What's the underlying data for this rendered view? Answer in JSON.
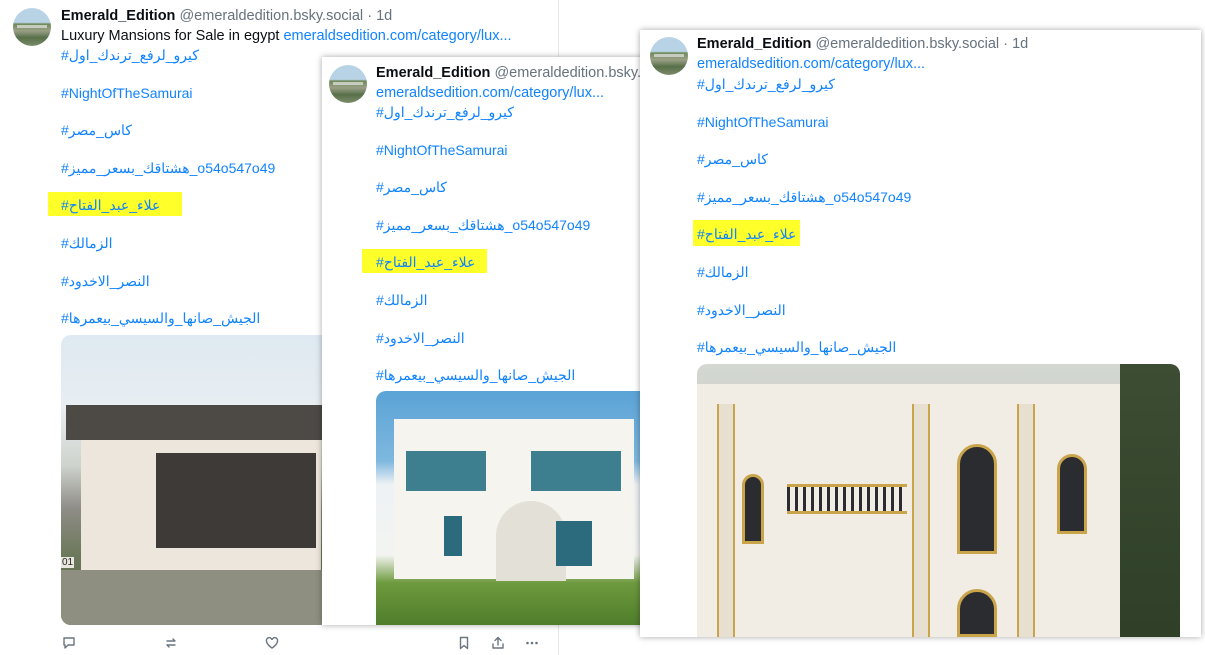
{
  "posts": [
    {
      "author": {
        "name": "Emerald_Edition",
        "handle": "@emeraldedition.bsky.social",
        "dot": "·",
        "time": "1d"
      },
      "text_prefix": "Luxury Mansions for Sale in egypt ",
      "link": "emeraldsedition.com/category/lux...",
      "hashtags": [
        "#كيرو_لرفع_ترندك_اول",
        "#NightOfTheSamurai",
        "#كاس_مصر",
        "#هشتاقك_بسعر_مميز_o54o547o49",
        "#علاء_عبد_الفتاح",
        "#الزمالك",
        "#النصر_الاخدود",
        "#الجيش_صانها_والسيسي_بيعمرها"
      ],
      "highlighted_index": 4,
      "image_alt": "modern single-storey villa",
      "image_number": "01"
    },
    {
      "author": {
        "name": "Emerald_Edition",
        "handle": "@emeraldedition.bsky.",
        "dot": "",
        "time": ""
      },
      "text_prefix": "",
      "link": "emeraldsedition.com/category/lux...",
      "hashtags": [
        "#كيرو_لرفع_ترندك_اول",
        "#NightOfTheSamurai",
        "#كاس_مصر",
        "#هشتاقك_بسعر_مميز_o54o547o49",
        "#علاء_عبد_الفتاح",
        "#الزمالك",
        "#النصر_الاخدود",
        "#الجيش_صانها_والسيسي_بيعمرها"
      ],
      "highlighted_index": 4,
      "image_alt": "white coastal villa with blue pergola"
    },
    {
      "author": {
        "name": "Emerald_Edition",
        "handle": "@emeraldedition.bsky.social",
        "dot": "·",
        "time": "1d"
      },
      "text_prefix": "",
      "link": "emeraldsedition.com/category/lux...",
      "hashtags": [
        "#كيرو_لرفع_ترندك_اول",
        "#NightOfTheSamurai",
        "#كاس_مصر",
        "#هشتاقك_بسعر_مميز_o54o547o49",
        "#علاء_عبد_الفتاح",
        "#الزمالك",
        "#النصر_الاخدود",
        "#الجيش_صانها_والسيسي_بيعمرها"
      ],
      "highlighted_index": 4,
      "image_alt": "ornate white and gold classical mansion"
    }
  ],
  "actions": {
    "reply_icon": "reply-icon",
    "repost_icon": "repost-icon",
    "like_icon": "heart-icon",
    "bookmark_icon": "bookmark-icon",
    "share_icon": "share-icon",
    "more_icon": "more-icon"
  },
  "colors": {
    "link": "#1083fe",
    "highlight": "#ffff2a",
    "muted": "#66727e"
  }
}
